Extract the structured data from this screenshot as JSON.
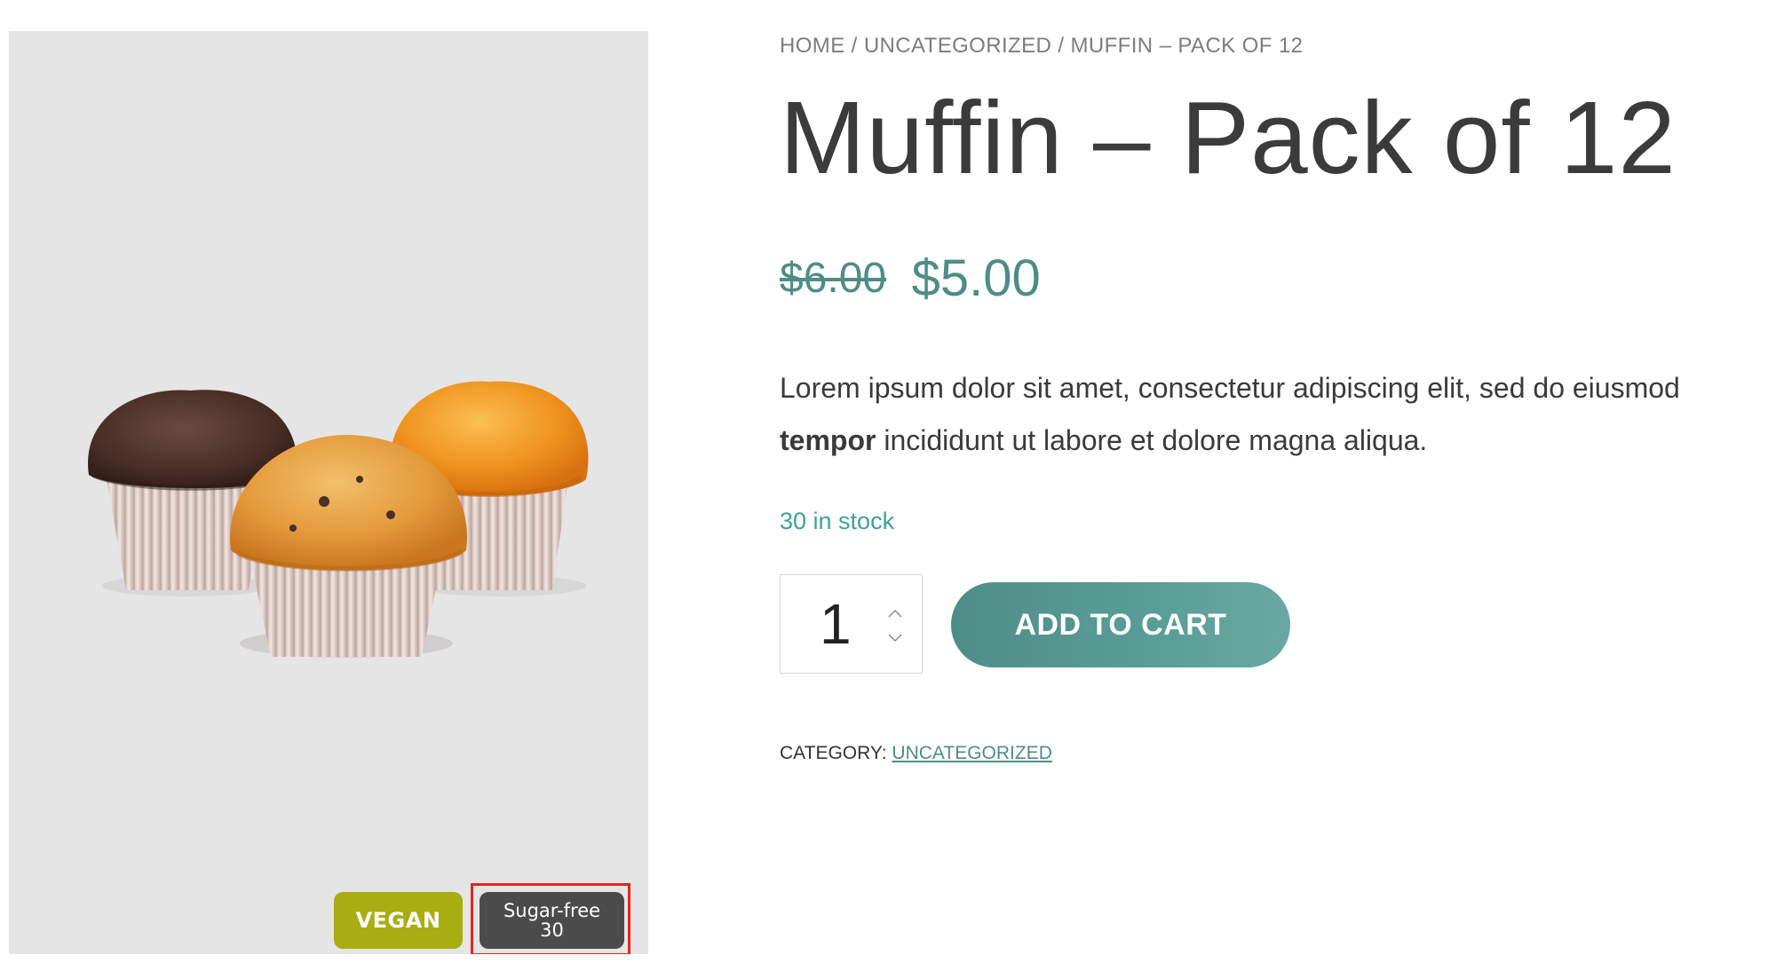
{
  "breadcrumb": {
    "home": "HOME",
    "sep1": " / ",
    "category": "UNCATEGORIZED",
    "sep2": " / ",
    "current": "MUFFIN – PACK OF 12"
  },
  "product": {
    "title": "Muffin – Pack of 12",
    "old_price": "$6.00",
    "new_price": "$5.00",
    "description": {
      "part1": "Lorem ipsum dolor sit amet, consectetur adipiscing elit, sed do eiusmod ",
      "bold": "tempor",
      "part2": " incididunt ut labore et dolore magna aliqua."
    },
    "stock": "30 in stock",
    "quantity": "1",
    "add_to_cart": "ADD TO CART",
    "category_label": "CATEGORY: ",
    "category_value": "UNCATEGORIZED"
  },
  "badges": {
    "vegan": "VEGAN",
    "sugar_free_label": "Sugar-free",
    "sugar_free_value": "30"
  },
  "icons": {
    "qty_up": "chevron-up-icon",
    "qty_down": "chevron-down-icon"
  },
  "colors": {
    "accent": "#4e8d87",
    "stock": "#3fa19d",
    "vegan_badge": "#a8ad12",
    "sugar_badge": "#4b4b4b",
    "highlight": "#e0261d",
    "image_bg": "#e6e5e6"
  }
}
